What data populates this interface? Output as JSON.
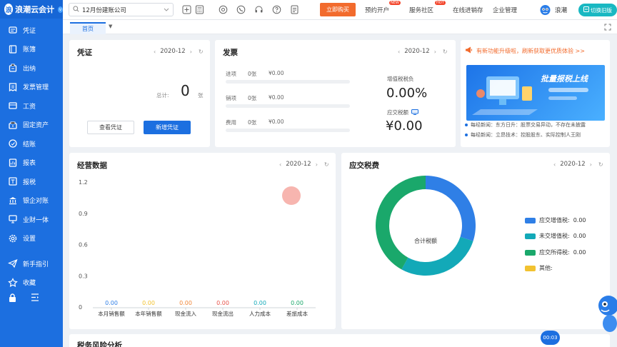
{
  "app": {
    "logo_text": "浪潮云会计",
    "logo_mark": "浪",
    "logo_badge": "v"
  },
  "sidebar": {
    "items": [
      {
        "label": "凭证",
        "icon": "voucher-icon"
      },
      {
        "label": "账簿",
        "icon": "ledger-icon"
      },
      {
        "label": "出纳",
        "icon": "cashier-icon"
      },
      {
        "label": "发票管理",
        "icon": "invoice-icon"
      },
      {
        "label": "工资",
        "icon": "salary-icon"
      },
      {
        "label": "固定资产",
        "icon": "asset-icon"
      },
      {
        "label": "结账",
        "icon": "closing-icon"
      },
      {
        "label": "报表",
        "icon": "report-icon"
      },
      {
        "label": "报税",
        "icon": "tax-icon"
      },
      {
        "label": "银企对账",
        "icon": "bank-icon"
      },
      {
        "label": "业财一体",
        "icon": "integration-icon"
      },
      {
        "label": "设置",
        "icon": "gear-icon"
      }
    ],
    "bottom": [
      {
        "label": "新手指引",
        "icon": "paper-plane-icon"
      },
      {
        "label": "收藏",
        "icon": "star-icon"
      }
    ]
  },
  "topbar": {
    "company": "12月份建账公司",
    "buy_label": "立即购买",
    "links": [
      {
        "label": "预约开户",
        "badge": "NEW"
      },
      {
        "label": "服务社区",
        "badge": "HOT"
      },
      {
        "label": "在线进销存",
        "badge": ""
      },
      {
        "label": "企业管理",
        "badge": ""
      }
    ],
    "user_name": "浪潮",
    "switch_label": "切换旧版"
  },
  "tabs": {
    "home": "首页"
  },
  "voucher": {
    "title": "凭证",
    "period": "2020-12",
    "total_label": "总计:",
    "total_count": "0",
    "unit": "张",
    "view_label": "查看凭证",
    "new_label": "新增凭证"
  },
  "invoice": {
    "title": "发票",
    "period": "2020-12",
    "rows": [
      {
        "type": "进项",
        "count": "0张",
        "amount": "¥0.00"
      },
      {
        "type": "销项",
        "count": "0张",
        "amount": "¥0.00"
      },
      {
        "type": "费用",
        "count": "0张",
        "amount": "¥0.00"
      }
    ],
    "vat_label": "增值税税负",
    "vat_value": "0.00%",
    "tax_due_label": "应交税额",
    "tax_due_value": "¥0.00"
  },
  "news": {
    "notice": "有新功能升级啦，刷新获取更优质体验 >>",
    "banner_text": "批量报税上线",
    "items": [
      "每经新闻：东方日升：股票交易异动，不存在未披露",
      "每经新闻：立昂技术：控股股东、实际控制人王刚"
    ]
  },
  "ops": {
    "title": "经营数据",
    "period": "2020-12"
  },
  "taxes": {
    "title": "应交税费",
    "period": "2020-12",
    "center_label": "合计税额",
    "legend": [
      {
        "label": "应交增值税:",
        "value": "0.00",
        "color": "#2f7fe6"
      },
      {
        "label": "未交增值税:",
        "value": "0.00",
        "color": "#13a9b8"
      },
      {
        "label": "应交所得税:",
        "value": "0.00",
        "color": "#1aa86b"
      },
      {
        "label": "其他:",
        "value": "",
        "color": "#f2c230"
      }
    ]
  },
  "risk": {
    "title": "税务风险分析"
  },
  "timer": "00:03",
  "chart_data": [
    {
      "type": "bar",
      "title": "经营数据",
      "categories": [
        "本月销售额",
        "本年销售额",
        "现金流入",
        "现金流出",
        "人力成本",
        "差旅成本"
      ],
      "values": [
        0.0,
        0.0,
        0.0,
        0.0,
        0.0,
        0.0
      ],
      "value_labels": [
        "0.00",
        "0.00",
        "0.00",
        "0.00",
        "0.00",
        "0.00"
      ],
      "value_colors": [
        "#2f7fe6",
        "#f2c230",
        "#f0883a",
        "#e8534a",
        "#13a9b8",
        "#1aa86b"
      ],
      "yticks": [
        "1.2",
        "0.9",
        "0.6",
        "0.3",
        "0"
      ],
      "ylim": [
        0,
        1.2
      ]
    },
    {
      "type": "pie",
      "title": "应交税费",
      "labels": [
        "应交增值税",
        "未交增值税",
        "应交所得税",
        "其他"
      ],
      "values": [
        0.3,
        0.28,
        0.42,
        0
      ],
      "colors": [
        "#2f7fe6",
        "#13a9b8",
        "#1aa86b",
        "#f2c230"
      ]
    }
  ]
}
